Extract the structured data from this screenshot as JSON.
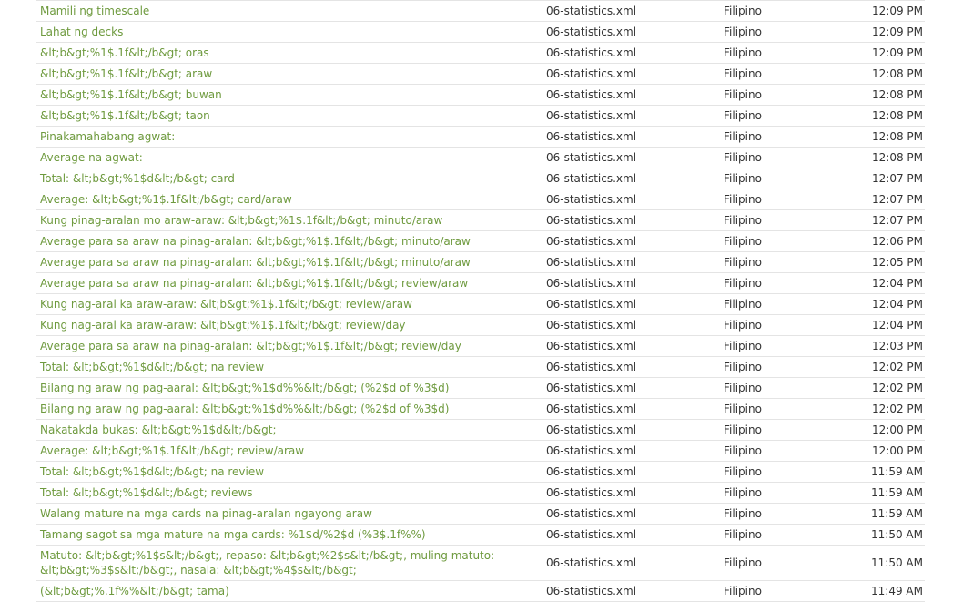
{
  "rows": [
    {
      "text": "Mamili ng timescale",
      "file": "06-statistics.xml",
      "lang": "Filipino",
      "time": "12:09 PM"
    },
    {
      "text": "Lahat ng decks",
      "file": "06-statistics.xml",
      "lang": "Filipino",
      "time": "12:09 PM"
    },
    {
      "text": "&lt;b&gt;%1$.1f&lt;/b&gt; oras",
      "file": "06-statistics.xml",
      "lang": "Filipino",
      "time": "12:09 PM"
    },
    {
      "text": "&lt;b&gt;%1$.1f&lt;/b&gt; araw",
      "file": "06-statistics.xml",
      "lang": "Filipino",
      "time": "12:08 PM"
    },
    {
      "text": "&lt;b&gt;%1$.1f&lt;/b&gt; buwan",
      "file": "06-statistics.xml",
      "lang": "Filipino",
      "time": "12:08 PM"
    },
    {
      "text": "&lt;b&gt;%1$.1f&lt;/b&gt; taon",
      "file": "06-statistics.xml",
      "lang": "Filipino",
      "time": "12:08 PM"
    },
    {
      "text": "Pinakamahabang agwat:",
      "file": "06-statistics.xml",
      "lang": "Filipino",
      "time": "12:08 PM"
    },
    {
      "text": "Average na agwat:",
      "file": "06-statistics.xml",
      "lang": "Filipino",
      "time": "12:08 PM"
    },
    {
      "text": "Total: &lt;b&gt;%1$d&lt;/b&gt; card",
      "file": "06-statistics.xml",
      "lang": "Filipino",
      "time": "12:07 PM"
    },
    {
      "text": "Average: &lt;b&gt;%1$.1f&lt;/b&gt; card/araw",
      "file": "06-statistics.xml",
      "lang": "Filipino",
      "time": "12:07 PM"
    },
    {
      "text": "Kung pinag-aralan mo araw-araw: &lt;b&gt;%1$.1f&lt;/b&gt; minuto/araw",
      "file": "06-statistics.xml",
      "lang": "Filipino",
      "time": "12:07 PM"
    },
    {
      "text": "Average para sa araw na pinag-aralan: &lt;b&gt;%1$.1f&lt;/b&gt; minuto/araw",
      "file": "06-statistics.xml",
      "lang": "Filipino",
      "time": "12:06 PM"
    },
    {
      "text": "Average para sa araw na pinag-aralan: &lt;b&gt;%1$.1f&lt;/b&gt; minuto/araw",
      "file": "06-statistics.xml",
      "lang": "Filipino",
      "time": "12:05 PM"
    },
    {
      "text": "Average para sa araw na pinag-aralan: &lt;b&gt;%1$.1f&lt;/b&gt; review/araw",
      "file": "06-statistics.xml",
      "lang": "Filipino",
      "time": "12:04 PM"
    },
    {
      "text": "Kung nag-aral ka araw-araw: &lt;b&gt;%1$.1f&lt;/b&gt; review/araw",
      "file": "06-statistics.xml",
      "lang": "Filipino",
      "time": "12:04 PM"
    },
    {
      "text": "Kung nag-aral ka araw-araw: &lt;b&gt;%1$.1f&lt;/b&gt; review/day",
      "file": "06-statistics.xml",
      "lang": "Filipino",
      "time": "12:04 PM"
    },
    {
      "text": "Average para sa araw na pinag-aralan: &lt;b&gt;%1$.1f&lt;/b&gt; review/day",
      "file": "06-statistics.xml",
      "lang": "Filipino",
      "time": "12:03 PM"
    },
    {
      "text": "Total: &lt;b&gt;%1$d&lt;/b&gt; na review",
      "file": "06-statistics.xml",
      "lang": "Filipino",
      "time": "12:02 PM"
    },
    {
      "text": "Bilang ng araw ng pag-aaral: &lt;b&gt;%1$d%%&lt;/b&gt; (%2$d of %3$d)",
      "file": "06-statistics.xml",
      "lang": "Filipino",
      "time": "12:02 PM"
    },
    {
      "text": "Bilang ng araw ng pag-aaral: &lt;b&gt;%1$d%%&lt;/b&gt; (%2$d of %3$d)",
      "file": "06-statistics.xml",
      "lang": "Filipino",
      "time": "12:02 PM"
    },
    {
      "text": "Nakatakda bukas: &lt;b&gt;%1$d&lt;/b&gt;",
      "file": "06-statistics.xml",
      "lang": "Filipino",
      "time": "12:00 PM"
    },
    {
      "text": "Average: &lt;b&gt;%1$.1f&lt;/b&gt; review/araw",
      "file": "06-statistics.xml",
      "lang": "Filipino",
      "time": "12:00 PM"
    },
    {
      "text": "Total: &lt;b&gt;%1$d&lt;/b&gt; na review",
      "file": "06-statistics.xml",
      "lang": "Filipino",
      "time": "11:59 AM"
    },
    {
      "text": "Total: &lt;b&gt;%1$d&lt;/b&gt; reviews",
      "file": "06-statistics.xml",
      "lang": "Filipino",
      "time": "11:59 AM"
    },
    {
      "text": "Walang mature na mga cards na pinag-aralan ngayong araw",
      "file": "06-statistics.xml",
      "lang": "Filipino",
      "time": "11:59 AM"
    },
    {
      "text": "Tamang sagot sa mga mature na mga cards: %1$d/%2$d (%3$.1f%%)",
      "file": "06-statistics.xml",
      "lang": "Filipino",
      "time": "11:50 AM"
    },
    {
      "text": "Matuto: &lt;b&gt;%1$s&lt;/b&gt;, repaso: &lt;b&gt;%2$s&lt;/b&gt;, muling matuto: &lt;b&gt;%3$s&lt;/b&gt;, nasala: &lt;b&gt;%4$s&lt;/b&gt;",
      "file": "06-statistics.xml",
      "lang": "Filipino",
      "time": "11:50 AM",
      "wrap": true
    },
    {
      "text": "(&lt;b&gt;%.1f%%&lt;/b&gt; tama)",
      "file": "06-statistics.xml",
      "lang": "Filipino",
      "time": "11:49 AM"
    }
  ]
}
